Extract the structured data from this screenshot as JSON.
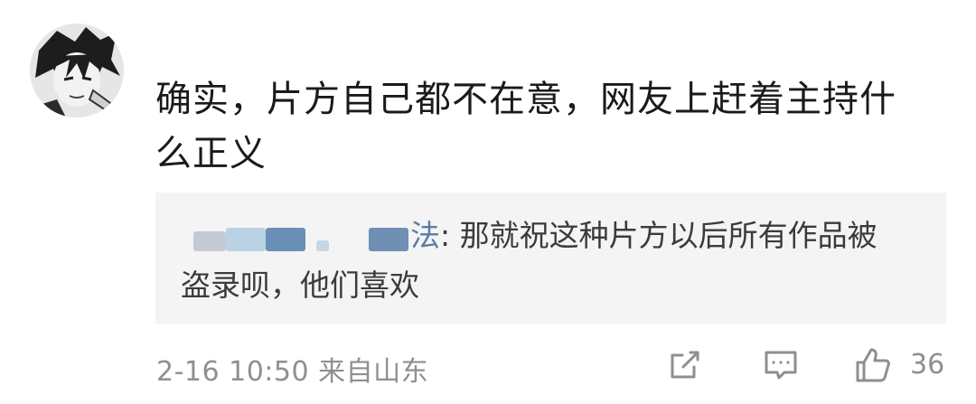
{
  "comment": {
    "text": "确实，片方自己都不在意，网友上赶着主持什么正义"
  },
  "reply": {
    "author_visible": "法",
    "separator": ": ",
    "text": "那就祝这种片方以后所有作品被盗录呗，他们喜欢"
  },
  "footer": {
    "meta": "2-16 10:50 来自山东",
    "like_count": "36"
  },
  "colors": {
    "link": "#5b7ca6",
    "meta": "#8f8f8f",
    "reply_bg": "#f4f4f4"
  },
  "icons": [
    "share-icon",
    "comment-icon",
    "like-icon"
  ]
}
